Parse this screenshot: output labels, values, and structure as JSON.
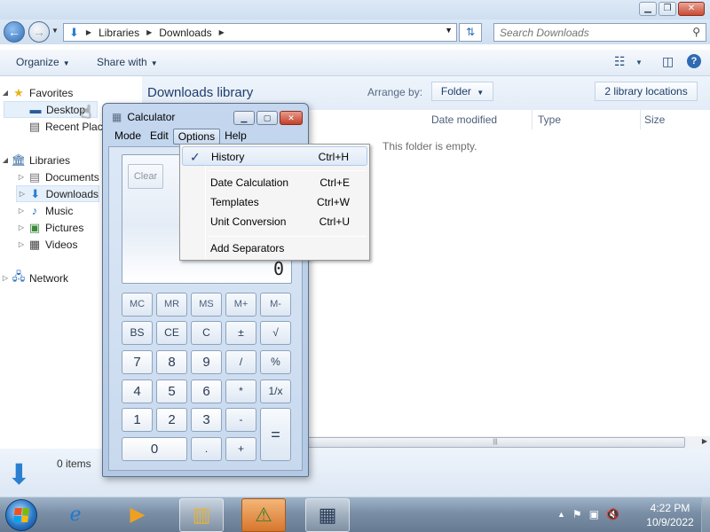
{
  "explorer": {
    "address": {
      "segments": [
        "Libraries",
        "Downloads"
      ]
    },
    "search": {
      "placeholder": "Search Downloads"
    },
    "toolbar": {
      "organize": "Organize",
      "share_with": "Share with"
    },
    "nav": {
      "favorites": "Favorites",
      "desktop": "Desktop",
      "recent_places": "Recent Plac",
      "libraries": "Libraries",
      "documents": "Documents",
      "downloads": "Downloads",
      "music": "Music",
      "pictures": "Pictures",
      "videos": "Videos",
      "network": "Network"
    },
    "library": {
      "title": "Downloads library",
      "arrange_by_label": "Arrange by:",
      "arrange_value": "Folder",
      "locations_button": "2 library locations"
    },
    "columns": [
      "Date modified",
      "Type",
      "Size"
    ],
    "empty_message": "This folder is empty.",
    "status": {
      "item_count": "0 items"
    }
  },
  "calculator": {
    "title": "Calculator",
    "menu": [
      "Mode",
      "Edit",
      "Options",
      "Help"
    ],
    "history_clear": "Clear",
    "display_value": "0",
    "keys": {
      "row1": [
        "MC",
        "MR",
        "MS",
        "M+",
        "M-"
      ],
      "row2": [
        "BS",
        "CE",
        "C",
        "±",
        "√"
      ],
      "row3": [
        "7",
        "8",
        "9",
        "/",
        "%"
      ],
      "row4": [
        "4",
        "5",
        "6",
        "*",
        "1/x"
      ],
      "row5": [
        "1",
        "2",
        "3",
        "-"
      ],
      "row6": [
        "0",
        ".",
        "+"
      ],
      "equals": "="
    }
  },
  "options_menu": {
    "items": [
      {
        "label": "History",
        "shortcut": "Ctrl+H",
        "checked": true
      },
      {
        "label": "Date Calculation",
        "shortcut": "Ctrl+E"
      },
      {
        "label": "Templates",
        "shortcut": "Ctrl+W"
      },
      {
        "label": "Unit Conversion",
        "shortcut": "Ctrl+U"
      },
      {
        "label": "Add Separators",
        "shortcut": ""
      }
    ]
  },
  "taskbar": {
    "time": "4:22 PM",
    "date": "10/9/2022"
  },
  "colors": {
    "accent": "#2b78c7",
    "taskbar": "#7a8fa6",
    "menu_highlight": "#dfe9f6"
  }
}
